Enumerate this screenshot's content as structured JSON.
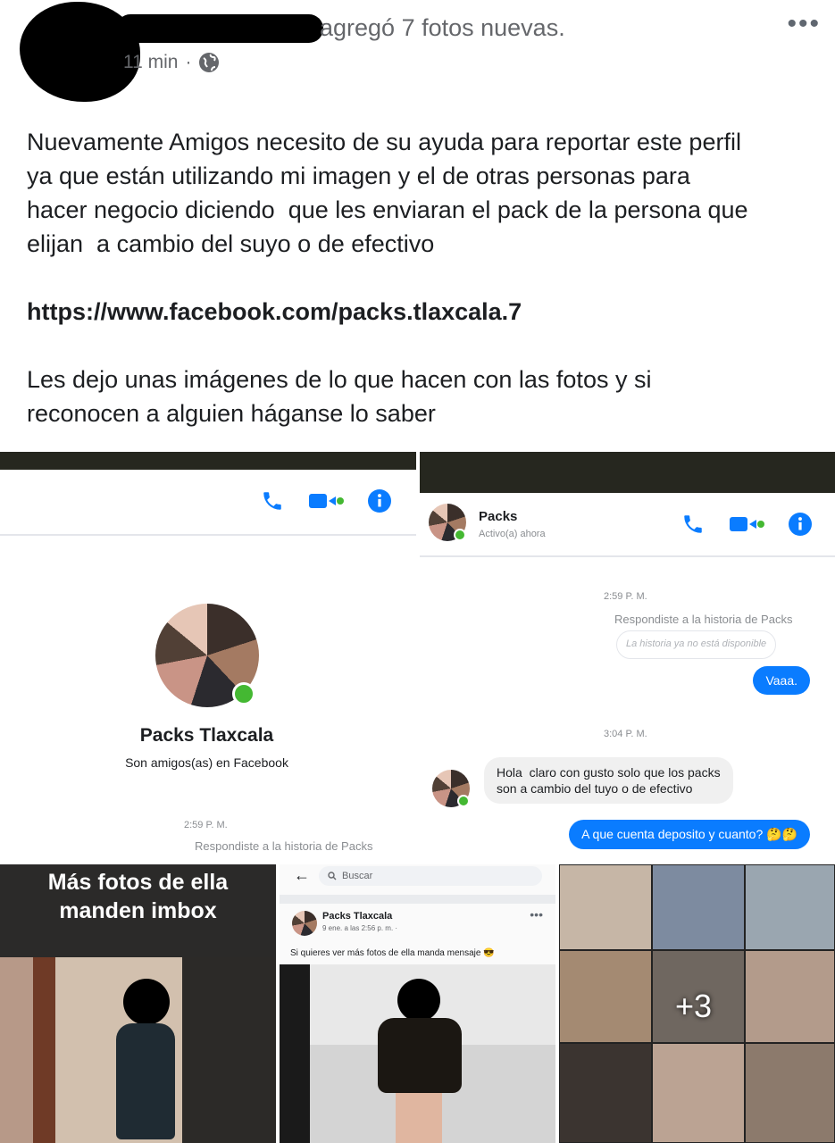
{
  "post": {
    "headline": "agregó 7 fotos nuevas.",
    "time": "11 min",
    "meta_sep": "·",
    "more_icon": "more-dots-icon",
    "privacy_icon": "globe-icon",
    "more_glyph": "•••",
    "body": "Nuevamente Amigos necesito de su ayuda para reportar este perfil\nya que están utilizando mi imagen y el de otras personas para\nhacer negocio diciendo  que les enviaran el pack de la persona que\nelijan  a cambio del suyo o de efectivo",
    "link": "https://www.facebook.com/packs.tlaxcala.7",
    "closing": "Les dejo unas imágenes de lo que hacen con las fotos y si\nreconocen a alguien háganse lo saber"
  },
  "screenshot_profile": {
    "name": "Packs Tlaxcala",
    "friends": "Son amigos(as) en Facebook",
    "time": "2:59 P. M.",
    "replied": "Respondiste a la historia de Packs"
  },
  "screenshot_chat": {
    "contact": "Packs",
    "status": "Activo(a) ahora",
    "time1": "2:59 P. M.",
    "replied": "Respondiste a la historia de Packs",
    "story_unavailable": "La historia ya no está disponible",
    "msg_out1": "Vaaa.",
    "time2": "3:04 P. M.",
    "msg_in": "Hola  claro con gusto solo que los packs\nson a cambio del tuyo o de efectivo",
    "msg_out2": "A que cuenta deposito y cuanto? 🤔🤔"
  },
  "screenshot_caption": {
    "text": "Más fotos de ella\nmanden imbox"
  },
  "screenshot_fbpost": {
    "back": "←",
    "search": "Buscar",
    "name": "Packs Tlaxcala",
    "meta": "9 ene. a las 2:56 p. m. ·",
    "dots": "•••",
    "text": "Si quieres ver más fotos de ella manda mensaje 😎"
  },
  "screenshot_collage": {
    "more": "+3"
  },
  "colors": {
    "messenger_blue": "#0a7cff",
    "online_green": "#44b832",
    "gray_text": "#65676b"
  }
}
